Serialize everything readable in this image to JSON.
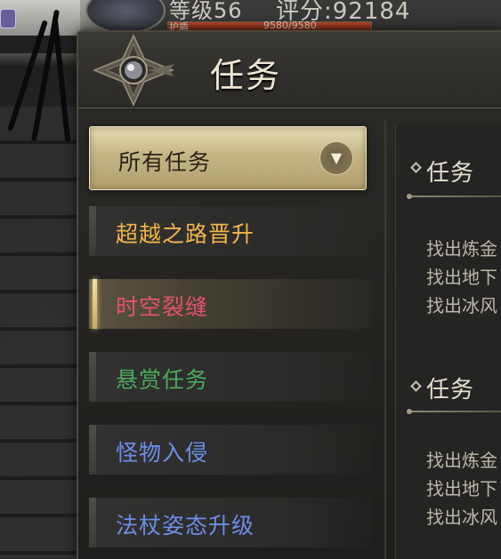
{
  "hud": {
    "level_text": "等级56",
    "score_text": "评分:92184",
    "hp_label": "护盾",
    "hp_text": "9580/9580",
    "hp_fraction": 1.0
  },
  "panel": {
    "title": "任务"
  },
  "filter": {
    "selected": "所有任务",
    "arrow": "▼"
  },
  "categories": [
    {
      "label": "超越之路晋升",
      "color": "#f0b64a"
    },
    {
      "label": "时空裂缝",
      "color": "#e4536a"
    },
    {
      "label": "悬赏任务",
      "color": "#4caa5c"
    },
    {
      "label": "怪物入侵",
      "color": "#6c8ee8"
    },
    {
      "label": "法杖姿态升级",
      "color": "#6c8ee8"
    }
  ],
  "detail": {
    "sections": [
      {
        "title": "任务",
        "lines": [
          "找出炼金",
          "找出地下",
          "找出冰风"
        ]
      },
      {
        "title": "任务",
        "lines": [
          "找出炼金",
          "找出地下",
          "找出冰风"
        ]
      }
    ]
  }
}
